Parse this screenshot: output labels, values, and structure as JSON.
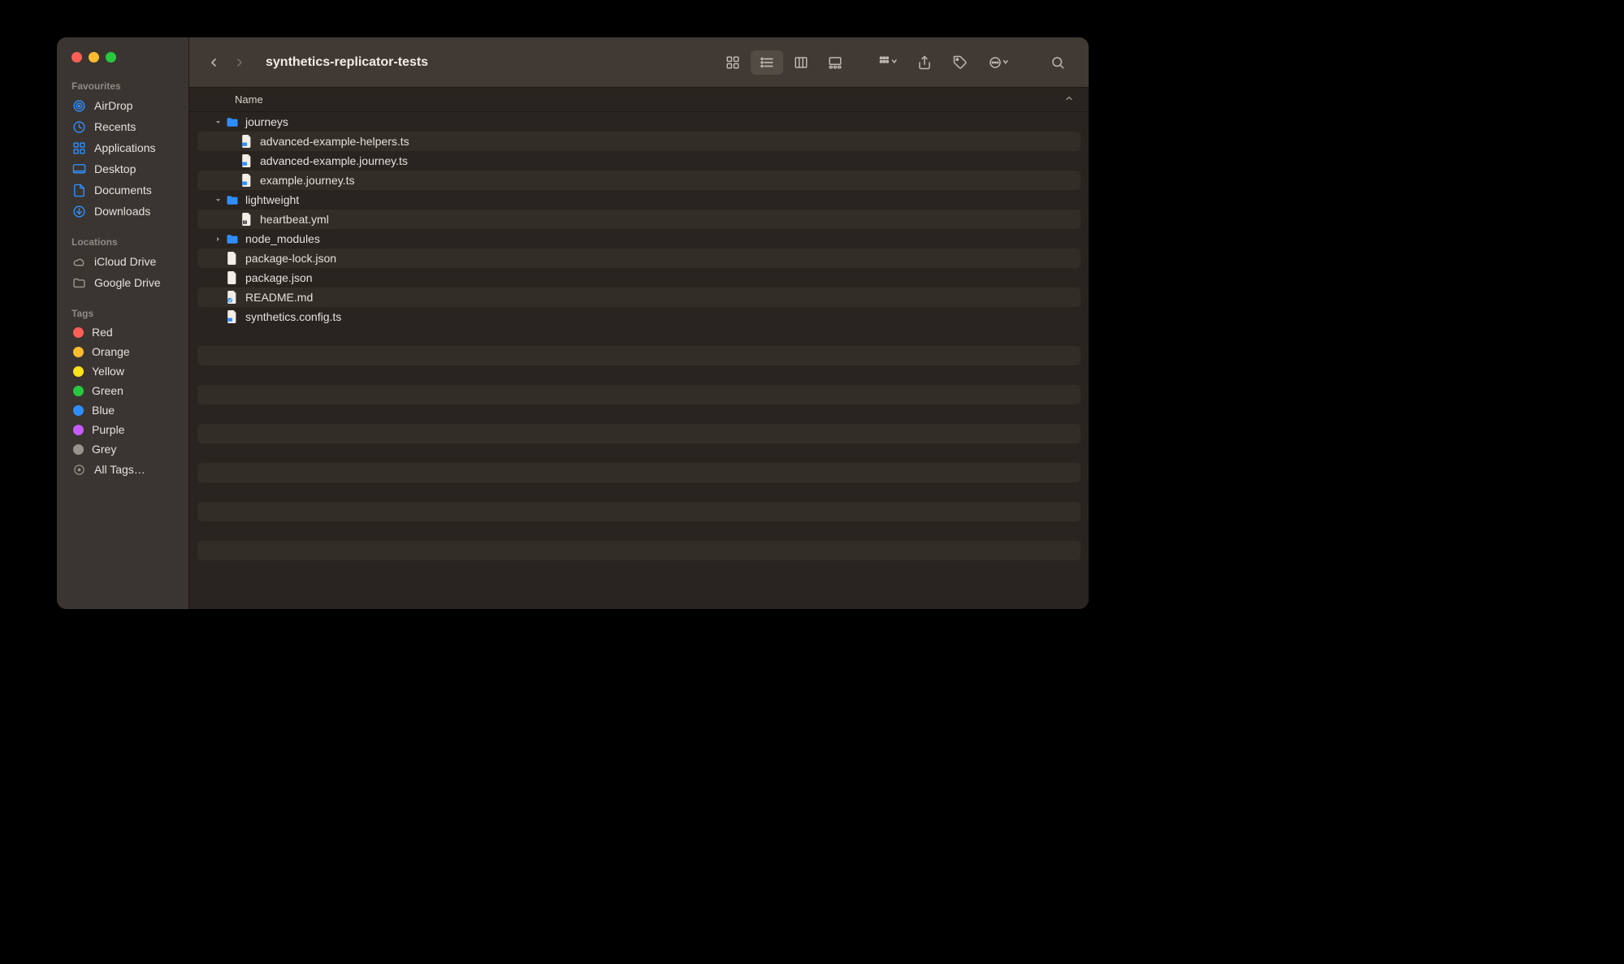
{
  "window": {
    "title": "synthetics-replicator-tests"
  },
  "sidebar": {
    "favourites_label": "Favourites",
    "favourites": [
      {
        "name": "AirDrop",
        "icon": "airdrop"
      },
      {
        "name": "Recents",
        "icon": "clock"
      },
      {
        "name": "Applications",
        "icon": "apps"
      },
      {
        "name": "Desktop",
        "icon": "desktop"
      },
      {
        "name": "Documents",
        "icon": "doc"
      },
      {
        "name": "Downloads",
        "icon": "download"
      }
    ],
    "locations_label": "Locations",
    "locations": [
      {
        "name": "iCloud Drive",
        "icon": "cloud"
      },
      {
        "name": "Google Drive",
        "icon": "folder"
      }
    ],
    "tags_label": "Tags",
    "tags": [
      {
        "name": "Red",
        "color": "#ff5f57"
      },
      {
        "name": "Orange",
        "color": "#febc2e"
      },
      {
        "name": "Yellow",
        "color": "#ffe11c"
      },
      {
        "name": "Green",
        "color": "#28c840"
      },
      {
        "name": "Blue",
        "color": "#2f8eff"
      },
      {
        "name": "Purple",
        "color": "#c65cff"
      },
      {
        "name": "Grey",
        "color": "#98938c"
      }
    ],
    "all_tags_label": "All Tags…"
  },
  "columns": {
    "name_label": "Name"
  },
  "tree": [
    {
      "name": "journeys",
      "type": "folder",
      "expanded": true,
      "depth": 0
    },
    {
      "name": "advanced-example-helpers.ts",
      "type": "ts",
      "depth": 1
    },
    {
      "name": "advanced-example.journey.ts",
      "type": "ts",
      "depth": 1
    },
    {
      "name": "example.journey.ts",
      "type": "ts",
      "depth": 1
    },
    {
      "name": "lightweight",
      "type": "folder",
      "expanded": true,
      "depth": 0
    },
    {
      "name": "heartbeat.yml",
      "type": "yml",
      "depth": 1
    },
    {
      "name": "node_modules",
      "type": "folder",
      "expanded": false,
      "depth": 0
    },
    {
      "name": "package-lock.json",
      "type": "json",
      "depth": 0
    },
    {
      "name": "package.json",
      "type": "json",
      "depth": 0
    },
    {
      "name": "README.md",
      "type": "md",
      "depth": 0
    },
    {
      "name": "synthetics.config.ts",
      "type": "ts",
      "depth": 0
    }
  ],
  "view_mode": "list"
}
